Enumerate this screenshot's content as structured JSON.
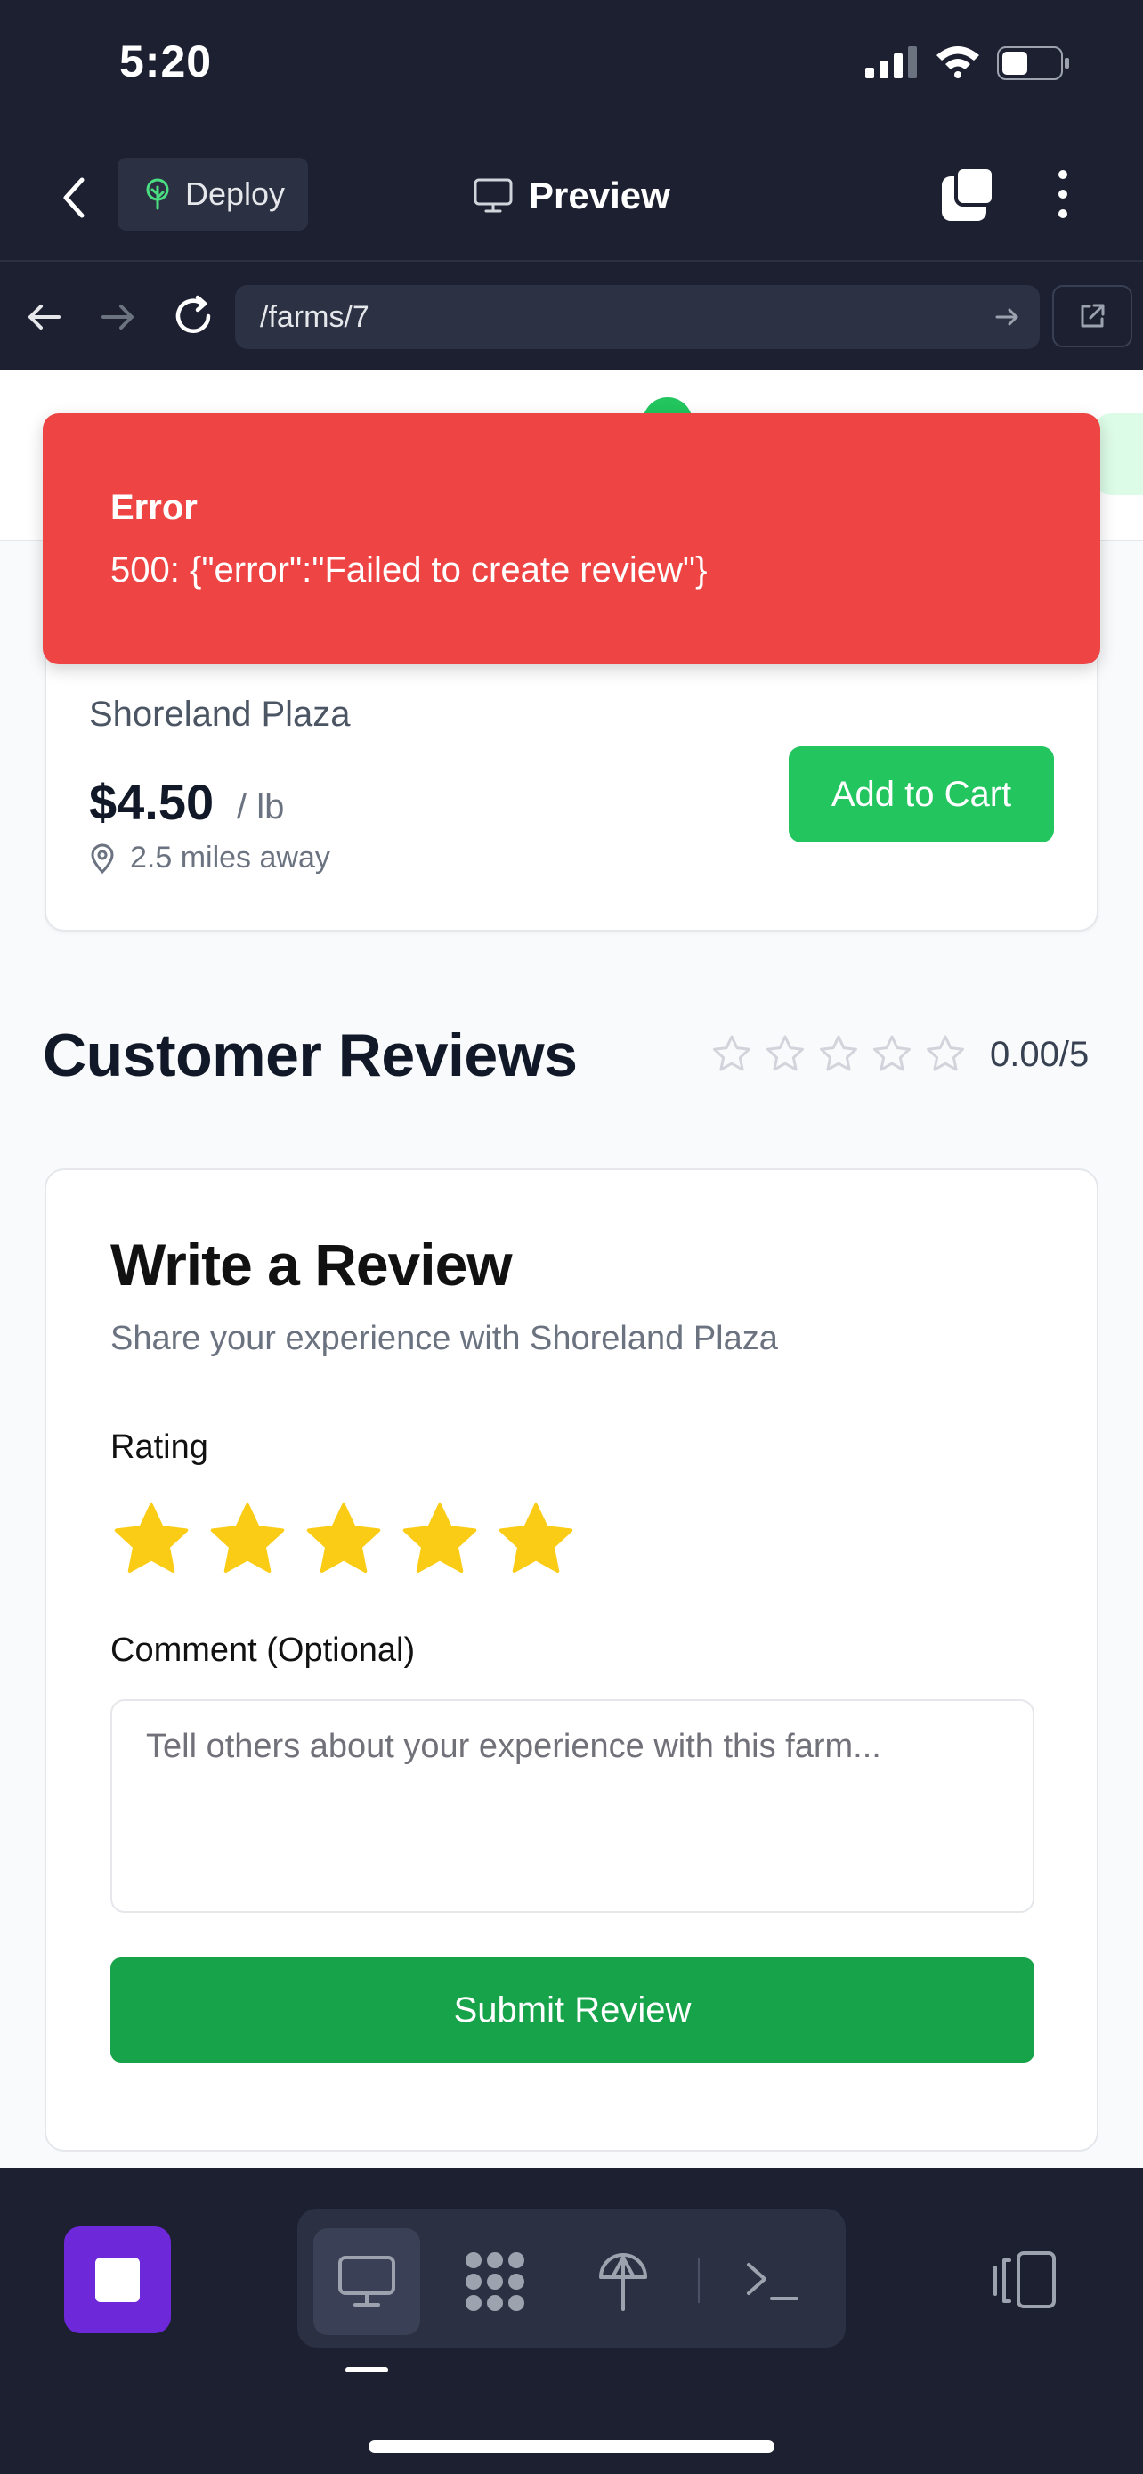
{
  "status_bar": {
    "time": "5:20"
  },
  "header": {
    "deploy_label": "Deploy",
    "preview_label": "Preview",
    "icons": [
      "back-icon",
      "tree-icon",
      "monitor-icon",
      "tabs-icon",
      "more-vertical-icon"
    ]
  },
  "browser": {
    "url": "/farms/7",
    "icons": [
      "arrow-left-icon",
      "arrow-right-icon",
      "reload-icon",
      "go-arrow-icon",
      "external-link-icon"
    ]
  },
  "product": {
    "farm_name": "Shoreland Plaza",
    "price": "$4.50",
    "unit": "/ lb",
    "distance": "2.5 miles away",
    "add_to_cart_label": "Add to Cart"
  },
  "reviews": {
    "title": "Customer Reviews",
    "average_rating": 0.0,
    "rating_text": "0.00/5",
    "max_stars": 5
  },
  "review_form": {
    "title": "Write a Review",
    "subtitle": "Share your experience with Shoreland Plaza",
    "rating_label": "Rating",
    "selected_rating": 5,
    "comment_label": "Comment (Optional)",
    "comment_placeholder": "Tell others about your experience with this farm...",
    "comment_value": "",
    "submit_label": "Submit Review"
  },
  "toast": {
    "title": "Error",
    "message": "500: {\"error\":\"Failed to create review\"}"
  },
  "colors": {
    "dark_bg": "#1c2030",
    "brand_green": "#22c55e",
    "submit_green": "#16a34a",
    "error_red": "#ef4444",
    "star_yellow": "#facc15",
    "stop_purple": "#6d28d9"
  },
  "bottom_toolbar": {
    "tools": [
      "preview-monitor-icon",
      "grid-dots-icon",
      "deploy-tree-icon",
      "terminal-icon"
    ],
    "active_tool": "preview-monitor-icon"
  }
}
